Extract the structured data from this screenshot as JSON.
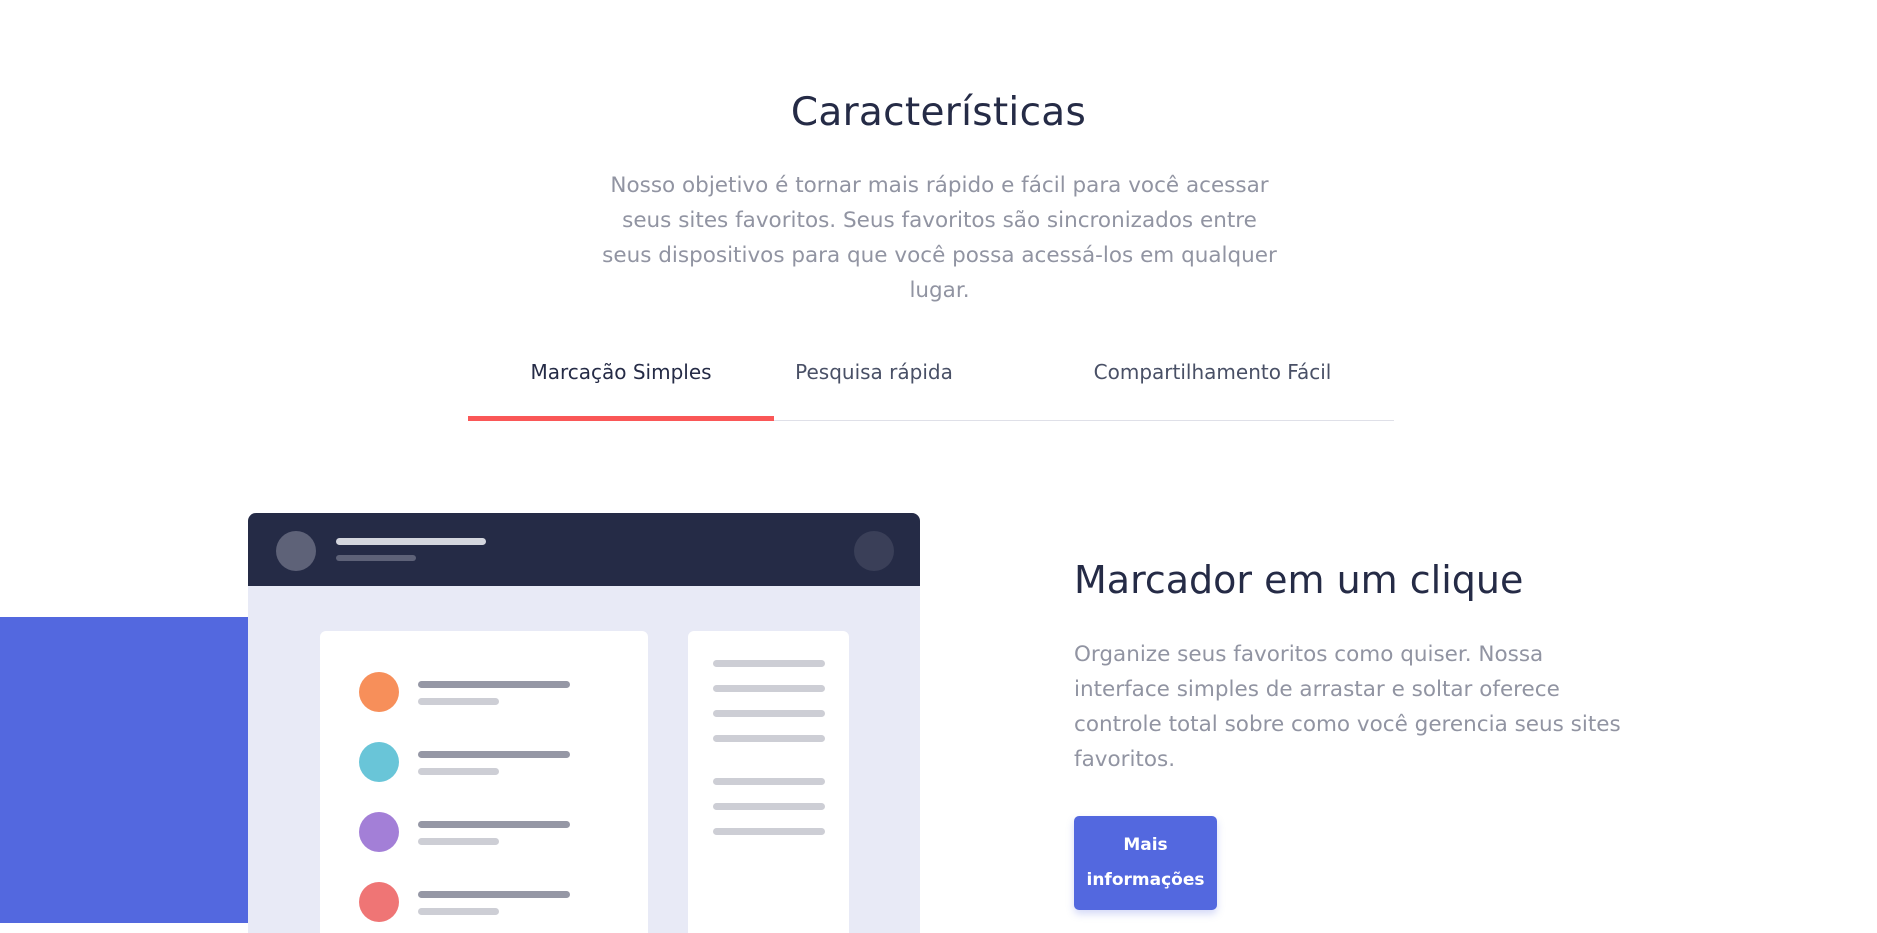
{
  "features": {
    "title": "Características",
    "intro": "Nosso objetivo é tornar mais rápido e fácil para você acessar seus sites favoritos. Seus favoritos são sincronizados entre seus dispositivos para que você possa acessá-los em qualquer lugar.",
    "tabs": [
      {
        "label": "Marcação Simples",
        "active": true
      },
      {
        "label": "Pesquisa rápida",
        "active": false
      },
      {
        "label": "Compartilhamento Fácil",
        "active": false
      }
    ]
  },
  "panel": {
    "title": "Marcador em um clique",
    "text": "Organize seus favoritos como quiser. Nossa interface simples de arrastar e soltar oferece controle total sobre como você gerencia seus sites favoritos.",
    "button_label": "Mais informações"
  },
  "illustration": {
    "bookmark_dot_colors": [
      "#f78f5a",
      "#69c5d8",
      "#a37fd7",
      "#ef7575"
    ],
    "accent_blue": "#5368df",
    "header_dark": "#252b46",
    "tab_underline": "#fa5757"
  }
}
